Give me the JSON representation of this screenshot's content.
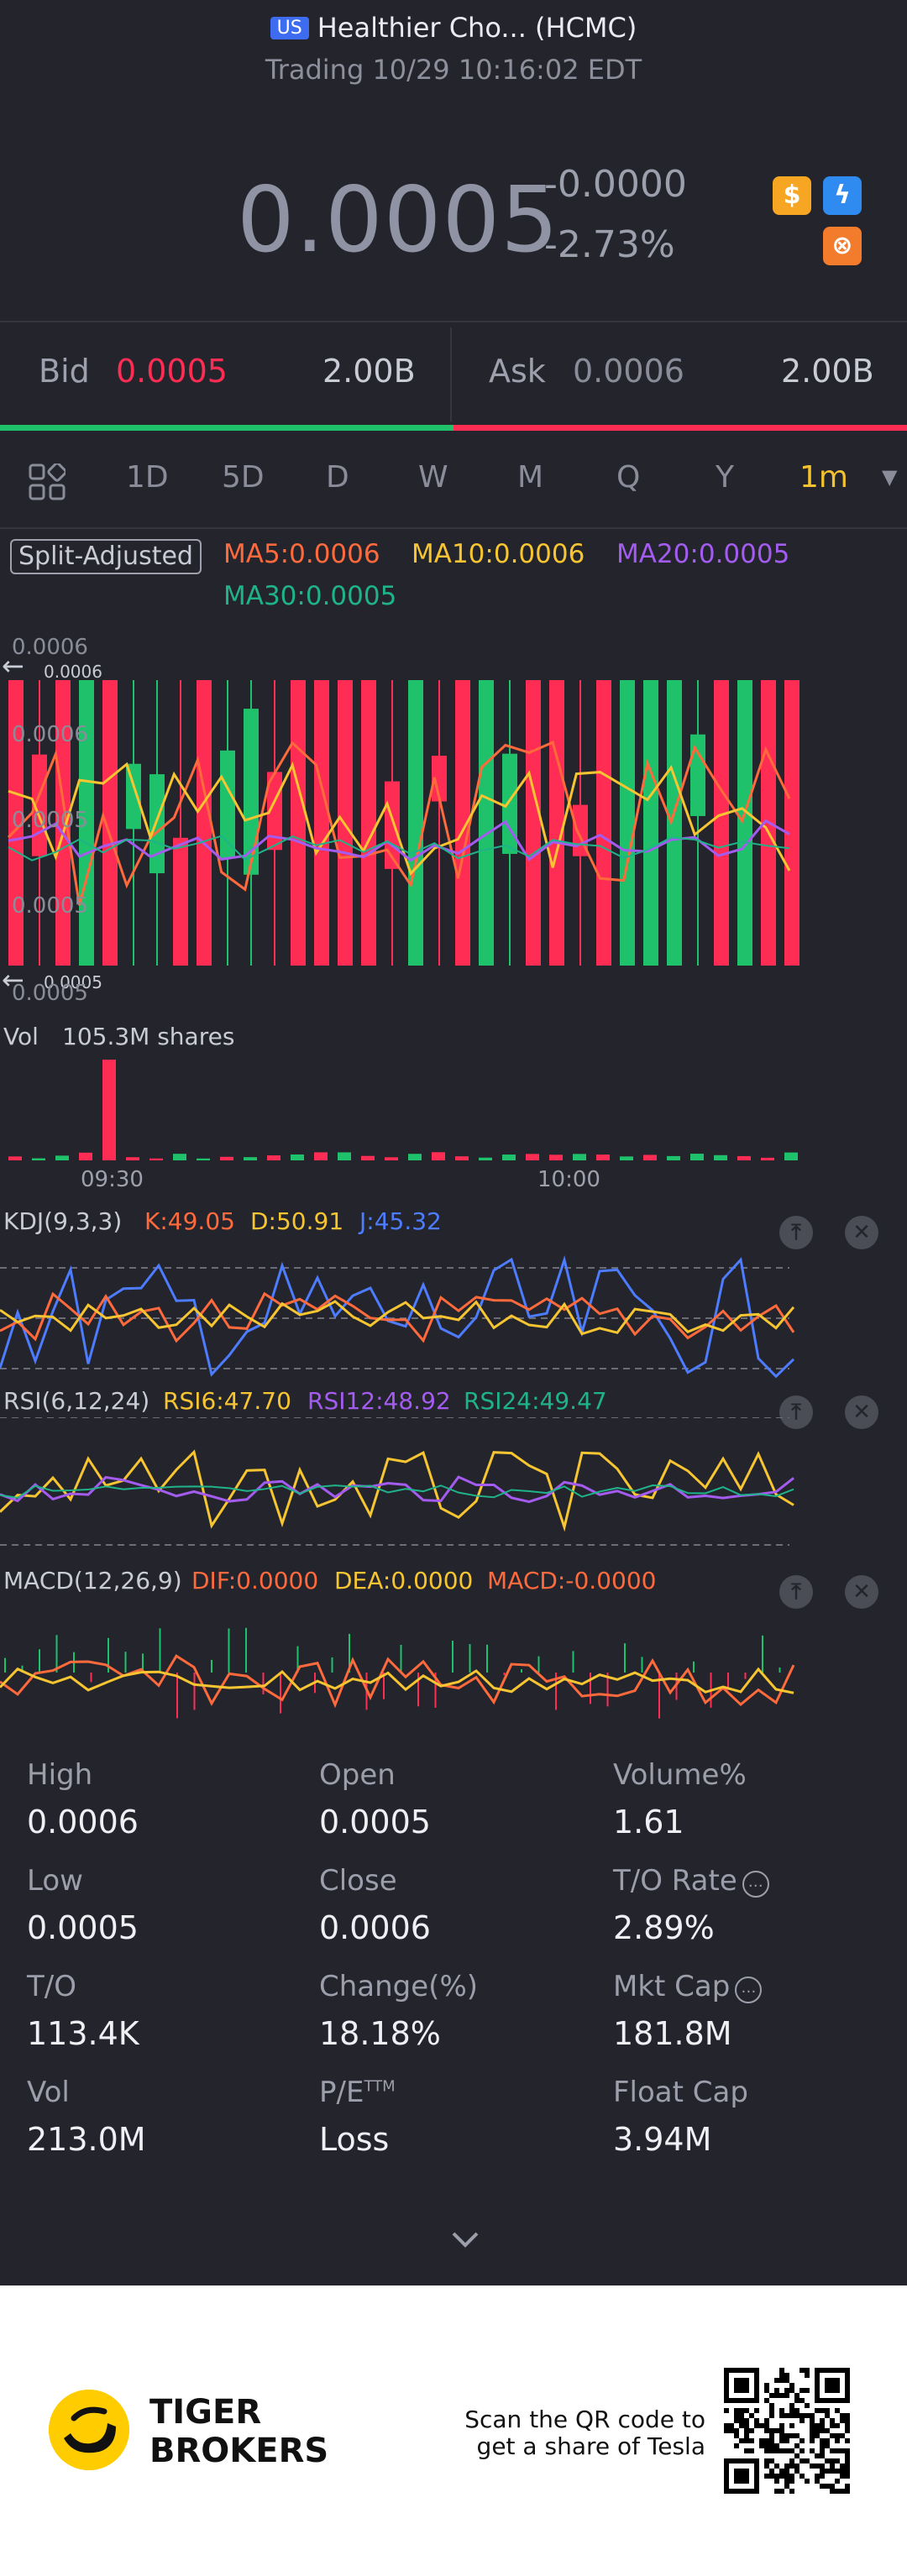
{
  "header": {
    "market_badge": "US",
    "title": "Healthier Cho... (HCMC)",
    "subtitle": "Trading 10/29 10:16:02 EDT"
  },
  "quote": {
    "price": "0.0005",
    "change": "-0.0000",
    "change_pct": "-2.73%",
    "icons": [
      "dollar-icon",
      "lightning-icon",
      "options-icon"
    ]
  },
  "bidask": {
    "bid_label": "Bid",
    "bid_price": "0.0005",
    "bid_size": "2.00B",
    "ask_label": "Ask",
    "ask_price": "0.0006",
    "ask_size": "2.00B",
    "bid_ratio": 0.5
  },
  "periods": [
    "1D",
    "5D",
    "D",
    "W",
    "M",
    "Q",
    "Y",
    "1m"
  ],
  "active_period": "1m",
  "ma": {
    "split": "Split-Adjusted",
    "ma5": "MA5:0.0006",
    "ma10": "MA10:0.0006",
    "ma20": "MA20:0.0005",
    "ma30": "MA30:0.0005"
  },
  "price_axis": {
    "top": "0.0006",
    "top_marker": "0.0006",
    "upper": "0.0006",
    "mid": "0.0005",
    "lower": "0.0005",
    "bottom": "0.0005",
    "bottom_marker": "0.0005"
  },
  "volume": {
    "label": "Vol",
    "value": "105.3M shares",
    "time_labels": [
      "09:30",
      "10:00"
    ]
  },
  "kdj": {
    "label": "KDJ(9,3,3)",
    "k": "K:49.05",
    "d": "D:50.91",
    "j": "J:45.32"
  },
  "rsi": {
    "label": "RSI(6,12,24)",
    "rsi6": "RSI6:47.70",
    "rsi12": "RSI12:48.92",
    "rsi24": "RSI24:49.47"
  },
  "macd": {
    "label": "MACD(12,26,9)",
    "dif": "DIF:0.0000",
    "dea": "DEA:0.0000",
    "macd": "MACD:-0.0000"
  },
  "colors": {
    "up": "#1fc16b",
    "down": "#ff2d54",
    "ma5": "#ff6a3d",
    "ma10": "#f7c531",
    "ma20": "#a45cf0",
    "ma30": "#1fb38a",
    "k": "#ff6a3d",
    "d": "#f7c531",
    "j": "#4d7cff"
  },
  "stats": [
    {
      "label": "High",
      "value": "0.0006"
    },
    {
      "label": "Open",
      "value": "0.0005"
    },
    {
      "label": "Volume%",
      "value": "1.61"
    },
    {
      "label": "Low",
      "value": "0.0005"
    },
    {
      "label": "Close",
      "value": "0.0006"
    },
    {
      "label": "T/O Rate",
      "value": "2.89%"
    },
    {
      "label": "T/O",
      "value": "113.4K"
    },
    {
      "label": "Change(%)",
      "value": "18.18%"
    },
    {
      "label": "Mkt Cap",
      "value": "181.8M"
    },
    {
      "label": "Vol",
      "value": "213.0M"
    },
    {
      "label": "P/E",
      "label_sup": "TTM",
      "value": "Loss"
    },
    {
      "label": "Float Cap",
      "value": "3.94M"
    }
  ],
  "footer": {
    "brand_line1": "TIGER",
    "brand_line2": "BROKERS",
    "scan_line1": "Scan the QR code to",
    "scan_line2": "get a share of Tesla"
  }
}
